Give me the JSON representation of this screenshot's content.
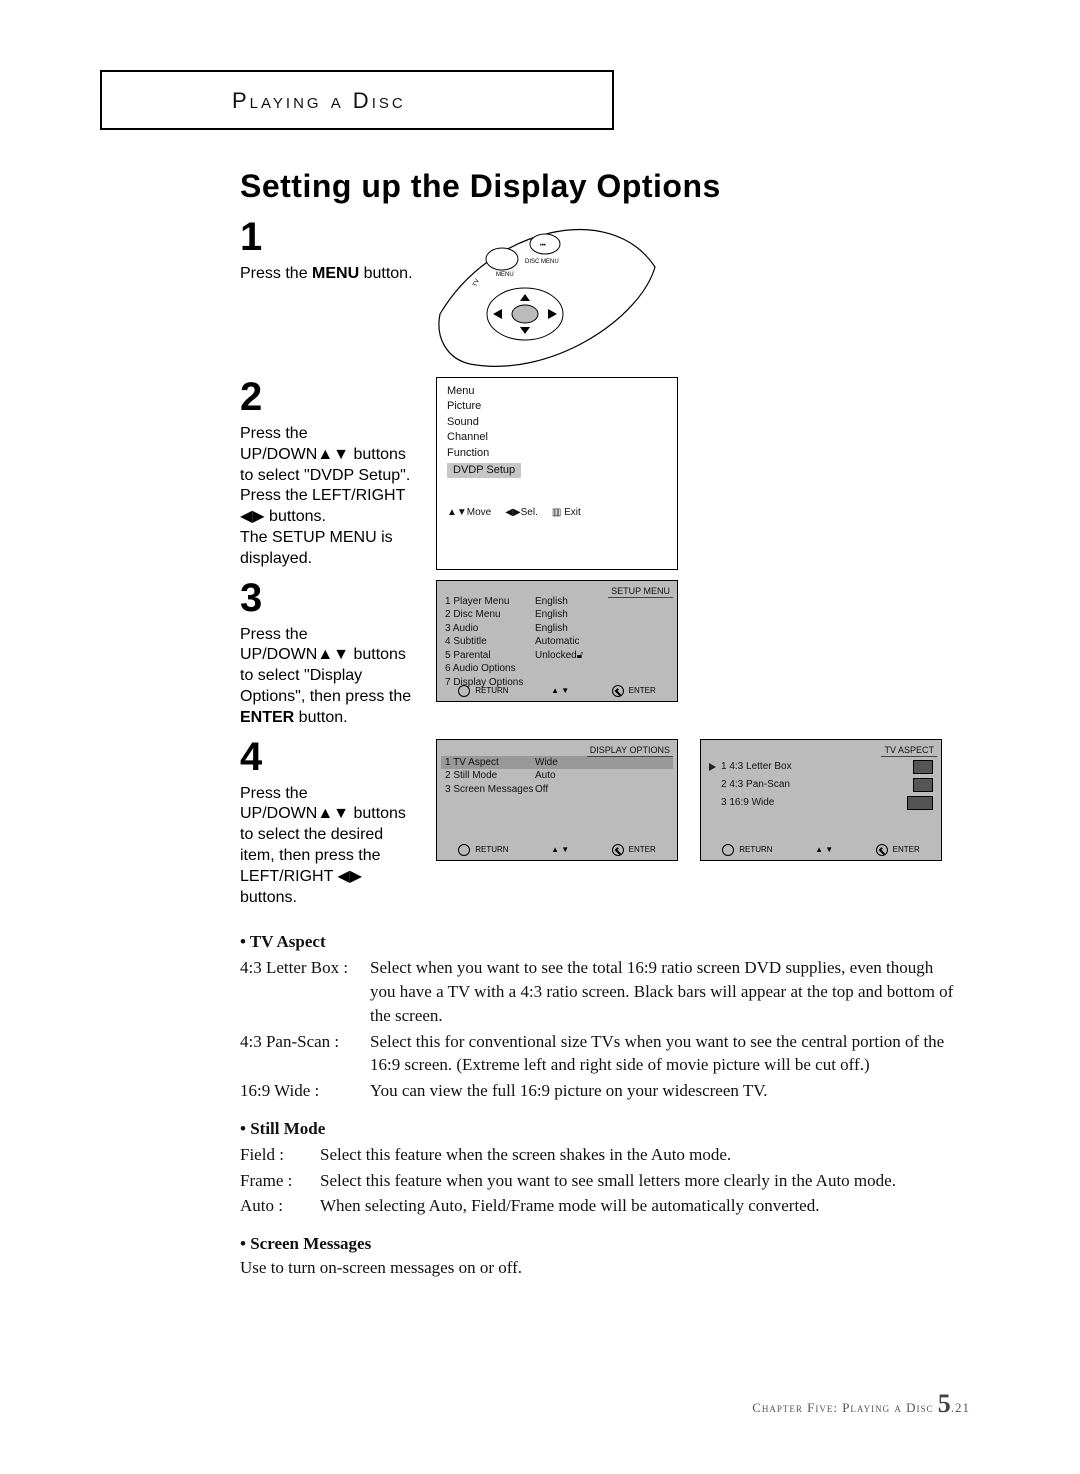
{
  "header": {
    "text": "Playing a Disc"
  },
  "section_title": "Setting up the Display Options",
  "steps": {
    "s1": {
      "num": "1",
      "line1": "Press the ",
      "bold1": "MENU",
      "line1b": " button."
    },
    "s2": {
      "num": "2",
      "text": "Press the UP/DOWN▲▼ buttons to select \"DVDP Setup\".\nPress the LEFT/RIGHT ◀▶ buttons.\nThe SETUP MENU is displayed.",
      "menu": {
        "items": [
          "Menu",
          "Picture",
          "Sound",
          "Channel",
          "Function"
        ],
        "highlight": "DVDP Setup",
        "footer1": "▲▼Move",
        "footer2": "◀▶Sel.",
        "footer3": "▥ Exit"
      }
    },
    "s3": {
      "num": "3",
      "line1": "Press the UP/DOWN▲▼ buttons to select \"Display Options\", then press the ",
      "bold1": "ENTER",
      "line1b": " button.",
      "panel_title": "SETUP  MENU",
      "menu_rows": [
        {
          "k": "1  Player Menu",
          "v": "English"
        },
        {
          "k": "2  Disc Menu",
          "v": "English"
        },
        {
          "k": "3  Audio",
          "v": "English"
        },
        {
          "k": "4  Subtitle",
          "v": "Automatic"
        },
        {
          "k": "5  Parental",
          "v": "Unlocked"
        },
        {
          "k": "6  Audio Options",
          "v": ""
        },
        {
          "k": "7  Display Options",
          "v": ""
        }
      ],
      "footer_return": "RETURN",
      "footer_arrows": "▲ ▼",
      "footer_enter": "ENTER"
    },
    "s4": {
      "num": "4",
      "text": "Press the UP/DOWN▲▼ buttons to select the desired item, then press the LEFT/RIGHT ◀▶ buttons.",
      "panelA_title": "DISPLAY  OPTIONS",
      "panelA_rows": [
        {
          "k": "1  TV Aspect",
          "v": "Wide"
        },
        {
          "k": "2  Still Mode",
          "v": "Auto"
        },
        {
          "k": "3  Screen Messages",
          "v": "Off"
        }
      ],
      "panelB_title": "TV  ASPECT",
      "panelB_rows": [
        {
          "label": "1  4:3 Letter Box"
        },
        {
          "label": "2  4:3 Pan-Scan"
        },
        {
          "label": "3  16:9 Wide"
        }
      ],
      "footer_return": "RETURN",
      "footer_arrows": "▲ ▼",
      "footer_enter": "ENTER"
    }
  },
  "notes": {
    "tv_aspect": {
      "head": "• TV Aspect",
      "items": [
        {
          "term": "4:3 Letter Box :",
          "desc": "Select when you want to see the total 16:9 ratio screen DVD supplies, even though you have a TV with a 4:3 ratio screen. Black bars will appear at the top and bottom of the screen."
        },
        {
          "term": "4:3 Pan-Scan :",
          "desc": "Select this for conventional size TVs when you want to see the central portion of the 16:9 screen. (Extreme left and right side of movie picture will be cut off.)"
        },
        {
          "term": "16:9 Wide :",
          "desc": "You can view the full 16:9 picture on your widescreen TV."
        }
      ]
    },
    "still_mode": {
      "head": "• Still Mode",
      "items": [
        {
          "term": "Field :",
          "desc": "Select this feature when the screen shakes in the Auto mode."
        },
        {
          "term": "Frame :",
          "desc": "Select this feature when you want to see small letters more clearly in the Auto mode."
        },
        {
          "term": "Auto :",
          "desc": "When selecting Auto, Field/Frame mode will be automatically converted."
        }
      ]
    },
    "screen_msg": {
      "head": "• Screen Messages",
      "text": "Use to turn on-screen messages on or off."
    }
  },
  "footer": {
    "chapter": "Chapter Five: Playing a Disc",
    "page_major": "5",
    "page_minor": ".21"
  }
}
